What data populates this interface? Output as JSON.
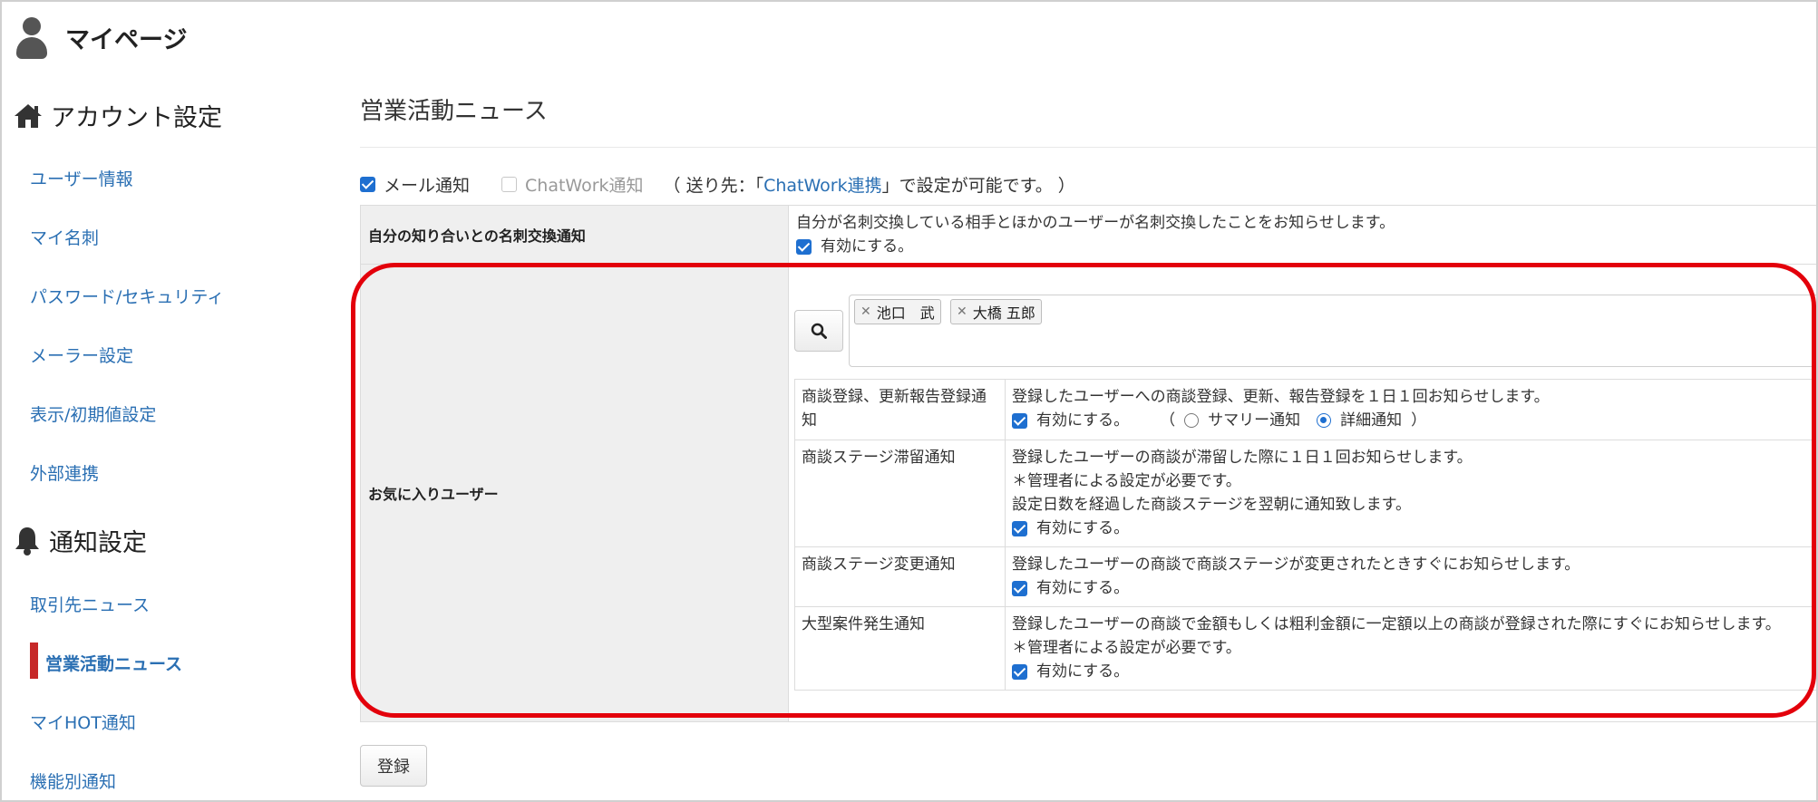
{
  "header": {
    "title": "マイページ"
  },
  "sidebar": {
    "account_heading": "アカウント設定",
    "account_items": [
      {
        "label": "ユーザー情報"
      },
      {
        "label": "マイ名刺"
      },
      {
        "label": "パスワード/セキュリティ"
      },
      {
        "label": "メーラー設定"
      },
      {
        "label": "表示/初期値設定"
      },
      {
        "label": "外部連携"
      }
    ],
    "notify_heading": "通知設定",
    "notify_items": [
      {
        "label": "取引先ニュース"
      },
      {
        "label": "営業活動ニュース",
        "active": true
      },
      {
        "label": "マイHOT通知"
      },
      {
        "label": "機能別通知"
      }
    ]
  },
  "main": {
    "title": "営業活動ニュース",
    "mail_notify": "メール通知",
    "chatwork_notify": "ChatWork通知",
    "dest_prefix": "（ 送り先：「 ",
    "dest_link": "ChatWork連携",
    "dest_suffix": " 」で設定が可能です。 ）",
    "card_exchange": {
      "label": "自分の知り合いとの名刺交換通知",
      "description": "自分が名刺交換している相手とほかのユーザーが名刺交換したことをお知らせします。",
      "enable": "有効にする。"
    },
    "favorites": {
      "label": "お気に入りユーザー",
      "tags": [
        "池口　武",
        "大橋 五郎"
      ],
      "rows": [
        {
          "name": "商談登録、更新報告登録通知",
          "lines": [
            "登録したユーザーへの商談登録、更新、報告登録を１日１回お知らせします。"
          ],
          "enable": "有効にする。",
          "radio_open": "（",
          "radio_summary": "サマリー通知",
          "radio_detail": "詳細通知",
          "radio_close": "）"
        },
        {
          "name": "商談ステージ滞留通知",
          "lines": [
            "登録したユーザーの商談が滞留した際に１日１回お知らせします。",
            "＊管理者による設定が必要です。",
            "設定日数を経過した商談ステージを翌朝に通知致します。"
          ],
          "enable": "有効にする。"
        },
        {
          "name": "商談ステージ変更通知",
          "lines": [
            "登録したユーザーの商談で商談ステージが変更されたときすぐにお知らせします。"
          ],
          "enable": "有効にする。"
        },
        {
          "name": "大型案件発生通知",
          "lines": [
            "登録したユーザーの商談で金額もしくは粗利金額に一定額以上の商談が登録された際にすぐにお知らせします。",
            "＊管理者による設定が必要です。"
          ],
          "enable": "有効にする。"
        }
      ]
    },
    "submit": "登録"
  },
  "colors": {
    "link": "#2a6fb3",
    "active_bar": "#c62828",
    "highlight": "#e3000b",
    "checkbox": "#1e6fd0"
  }
}
